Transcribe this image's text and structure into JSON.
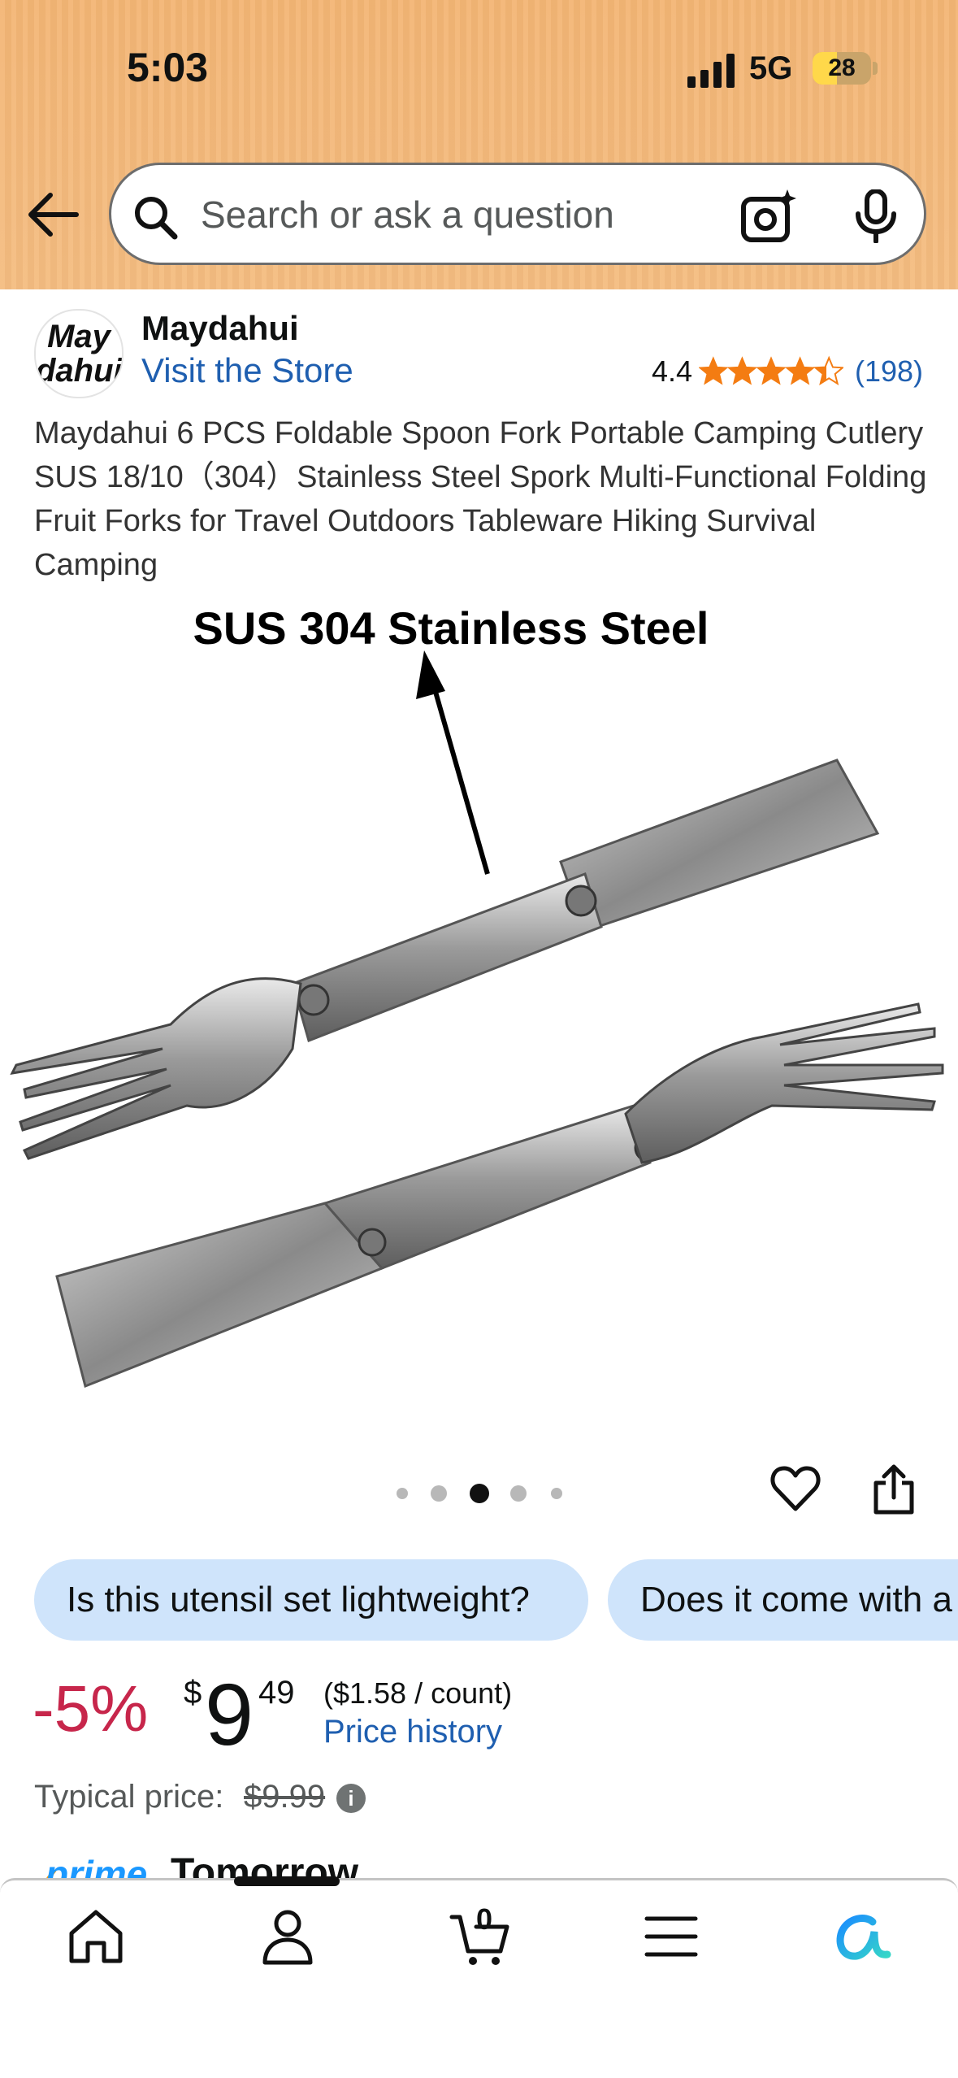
{
  "status_bar": {
    "time": "5:03",
    "network": "5G",
    "battery": "28"
  },
  "search": {
    "placeholder": "Search or ask a question"
  },
  "brand": {
    "logo_line1": "May",
    "logo_line2": "dahui",
    "name": "Maydahui",
    "visit_store": "Visit the Store"
  },
  "rating": {
    "value": "4.4",
    "count": "(198)",
    "stars": 4.4
  },
  "product": {
    "title": "Maydahui 6 PCS Foldable Spoon Fork Portable Camping Cutlery SUS 18/10（304）Stainless Steel Spork Multi-Functional Folding Fruit Forks for Travel Outdoors Tableware Hiking Survival Camping",
    "image_caption": "SUS 304 Stainless Steel"
  },
  "carousel": {
    "count": 5,
    "active_index": 2
  },
  "questions": [
    "Is this utensil set lightweight?",
    "Does it come with a"
  ],
  "price": {
    "discount": "-5%",
    "currency": "$",
    "whole": "9",
    "fraction": "49",
    "unit_price": "($1.58 / count)",
    "history_link": "Price history",
    "typical_label": "Typical price:",
    "typical_value": "$9.99",
    "info_icon": "i"
  },
  "delivery": {
    "prime_label": "prime",
    "text": "Tomorrow"
  },
  "bottom_nav": {
    "cart_count": "0",
    "items": [
      "home-icon",
      "account-icon",
      "cart-icon",
      "menu-icon",
      "rufus-icon"
    ]
  },
  "colors": {
    "header_bg": "#f4b877",
    "link": "#1f5fb0",
    "discount": "#c7264b",
    "chip_bg": "#cfe4fb",
    "star": "#f47c12"
  }
}
